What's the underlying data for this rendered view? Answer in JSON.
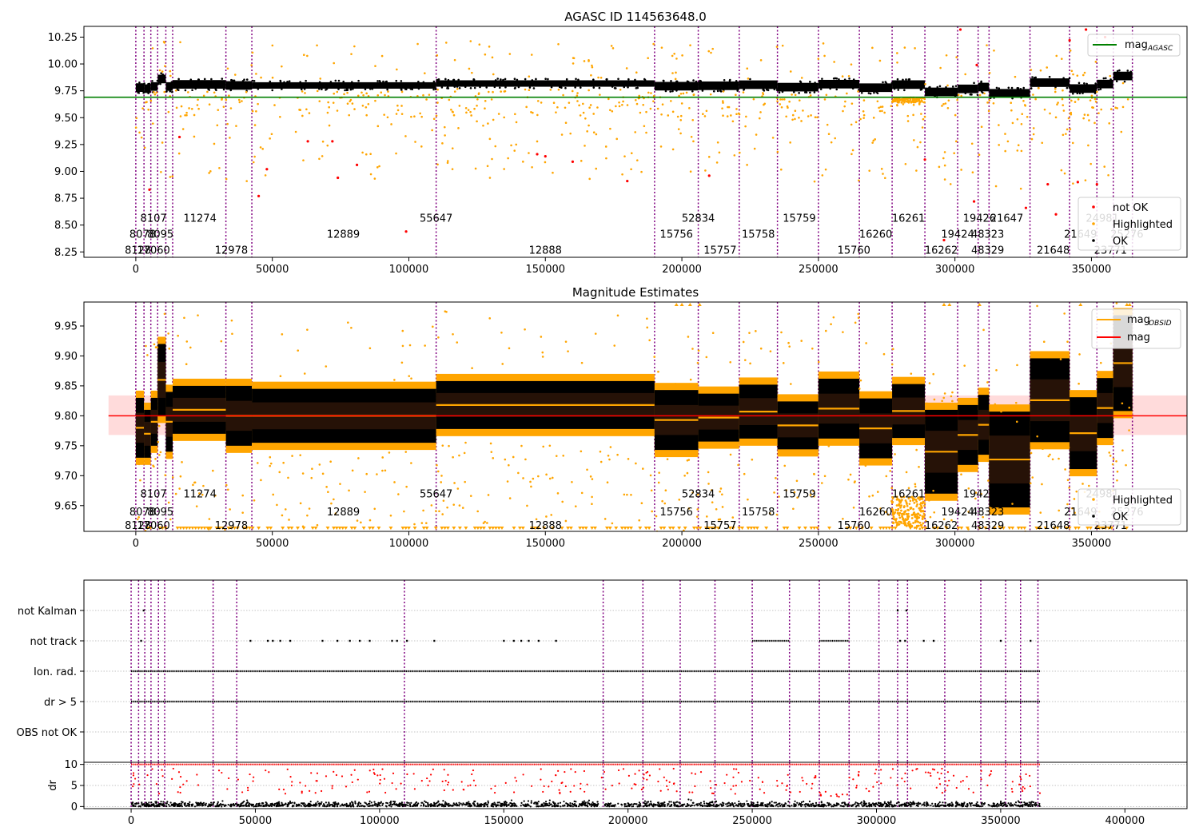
{
  "chart_data": [
    {
      "type": "scatter",
      "title": "AGASC ID 114563648.0",
      "xlim": [
        -19000,
        385000
      ],
      "ylim": [
        8.2,
        10.35
      ],
      "x_ticks": [
        0,
        50000,
        100000,
        150000,
        200000,
        250000,
        300000,
        350000,
        400000
      ],
      "x_tick_labels": [
        "0",
        "50000",
        "100000",
        "150000",
        "200000",
        "250000",
        "300000",
        "350000",
        "400000"
      ],
      "y_ticks": [
        8.25,
        8.5,
        8.75,
        9.0,
        9.25,
        9.5,
        9.75,
        10.0,
        10.25
      ],
      "y_tick_labels": [
        "8.25",
        "8.50",
        "8.75",
        "9.00",
        "9.25",
        "9.50",
        "9.75",
        "10.00",
        "10.25"
      ],
      "agasc_mag": 9.69,
      "agasc_line_range": [
        -19000,
        385000
      ],
      "legend_top": {
        "position": "top-right",
        "label": "mag",
        "subscript": "AGASC",
        "color": "#008000"
      },
      "legend_bottom": {
        "position": "lower-right",
        "entries": [
          {
            "label": "not OK",
            "color": "#ff0000"
          },
          {
            "label": "Highlighted",
            "color": "#ffa500"
          },
          {
            "label": "OK",
            "color": "#000000"
          }
        ]
      },
      "obsid_labels": [
        {
          "x": 800,
          "row": 0,
          "text": "8128"
        },
        {
          "x": 6500,
          "row": 0,
          "text": "17060"
        },
        {
          "x": 35000,
          "row": 0,
          "text": "12978"
        },
        {
          "x": 150000,
          "row": 0,
          "text": "12888"
        },
        {
          "x": 214000,
          "row": 0,
          "text": "15757"
        },
        {
          "x": 263000,
          "row": 0,
          "text": "15760"
        },
        {
          "x": 295000,
          "row": 0,
          "text": "16262"
        },
        {
          "x": 312000,
          "row": 0,
          "text": "48329"
        },
        {
          "x": 336000,
          "row": 0,
          "text": "21648"
        },
        {
          "x": 357000,
          "row": 0,
          "text": "23771"
        },
        {
          "x": 2500,
          "row": 1,
          "text": "8078"
        },
        {
          "x": 9000,
          "row": 1,
          "text": "8095"
        },
        {
          "x": 76000,
          "row": 1,
          "text": "12889"
        },
        {
          "x": 198000,
          "row": 1,
          "text": "15756"
        },
        {
          "x": 228000,
          "row": 1,
          "text": "15758"
        },
        {
          "x": 271000,
          "row": 1,
          "text": "16260"
        },
        {
          "x": 301000,
          "row": 1,
          "text": "19424"
        },
        {
          "x": 312000,
          "row": 1,
          "text": "48323"
        },
        {
          "x": 346000,
          "row": 1,
          "text": "21649"
        },
        {
          "x": 363000,
          "row": 1,
          "text": "25276"
        },
        {
          "x": 6500,
          "row": 2,
          "text": "8107"
        },
        {
          "x": 23500,
          "row": 2,
          "text": "11274"
        },
        {
          "x": 110000,
          "row": 2,
          "text": "55647"
        },
        {
          "x": 206000,
          "row": 2,
          "text": "52834"
        },
        {
          "x": 243000,
          "row": 2,
          "text": "15759"
        },
        {
          "x": 283000,
          "row": 2,
          "text": "16261"
        },
        {
          "x": 309000,
          "row": 2,
          "text": "19426"
        },
        {
          "x": 319000,
          "row": 2,
          "text": "21647"
        },
        {
          "x": 354000,
          "row": 2,
          "text": "24981"
        }
      ],
      "segments": [
        {
          "start": 0,
          "end": 3000,
          "mag": 9.78
        },
        {
          "start": 3000,
          "end": 5500,
          "mag": 9.77
        },
        {
          "start": 5500,
          "end": 8000,
          "mag": 9.79
        },
        {
          "start": 8000,
          "end": 11000,
          "mag": 9.86
        },
        {
          "start": 11000,
          "end": 13500,
          "mag": 9.79
        },
        {
          "start": 13500,
          "end": 33000,
          "mag": 9.81
        },
        {
          "start": 33000,
          "end": 42500,
          "mag": 9.8
        },
        {
          "start": 42500,
          "end": 110000,
          "mag": 9.8
        },
        {
          "start": 110000,
          "end": 190000,
          "mag": 9.818
        },
        {
          "start": 190000,
          "end": 206000,
          "mag": 9.793
        },
        {
          "start": 206000,
          "end": 221000,
          "mag": 9.797
        },
        {
          "start": 221000,
          "end": 235000,
          "mag": 9.807
        },
        {
          "start": 235000,
          "end": 250000,
          "mag": 9.784
        },
        {
          "start": 250000,
          "end": 265000,
          "mag": 9.812
        },
        {
          "start": 265000,
          "end": 277000,
          "mag": 9.779
        },
        {
          "start": 277000,
          "end": 289000,
          "mag": 9.808
        },
        {
          "start": 289000,
          "end": 301000,
          "mag": 9.74
        },
        {
          "start": 301000,
          "end": 308500,
          "mag": 9.768
        },
        {
          "start": 308500,
          "end": 312500,
          "mag": 9.785
        },
        {
          "start": 312500,
          "end": 327500,
          "mag": 9.727
        },
        {
          "start": 327500,
          "end": 342000,
          "mag": 9.826
        },
        {
          "start": 342000,
          "end": 352000,
          "mag": 9.771
        },
        {
          "start": 352000,
          "end": 358000,
          "mag": 9.813
        },
        {
          "start": 358000,
          "end": 365000,
          "mag": 9.888
        }
      ],
      "obs_boundaries": [
        0,
        3000,
        5500,
        8000,
        11000,
        13500,
        33000,
        42500,
        110000,
        190000,
        206000,
        221000,
        235000,
        250000,
        265000,
        277000,
        289000,
        301000,
        308500,
        312500,
        327500,
        342000,
        352000,
        358000,
        365000
      ]
    },
    {
      "type": "scatter",
      "title": "Magnitude Estimates",
      "xlim": [
        -19000,
        385000
      ],
      "ylim": [
        9.607,
        9.99
      ],
      "y_ticks": [
        9.65,
        9.7,
        9.75,
        9.8,
        9.85,
        9.9,
        9.95
      ],
      "y_tick_labels": [
        "9.65",
        "9.70",
        "9.75",
        "9.80",
        "9.85",
        "9.90",
        "9.95"
      ],
      "mean_mag": 9.8,
      "mag_band": [
        9.768,
        9.834
      ],
      "legend_top": {
        "position": "top-right",
        "entries": [
          {
            "label": "mag",
            "subscript": "OBSID",
            "color": "#ffa500"
          },
          {
            "label": "mag",
            "subscript": "",
            "color": "#ff0000"
          }
        ]
      },
      "legend_bottom": {
        "position": "lower-right",
        "entries": [
          {
            "label": "Highlighted",
            "color": "#ffa500"
          },
          {
            "label": "OK",
            "color": "#000000"
          }
        ]
      }
    },
    {
      "type": "scatter",
      "title": "",
      "xlim": [
        -19000,
        425000
      ],
      "flags": [
        "OBS not OK",
        "dr > 5",
        "Ion. rad.",
        "not track",
        "not Kalman"
      ],
      "flag_tracks": [
        {
          "flag": "not Kalman",
          "ranges": [],
          "points": [
            5000,
            308500,
            312000
          ]
        },
        {
          "flag": "not track",
          "ranges": [
            [
              250000,
              265000
            ],
            [
              277000,
              289000
            ]
          ],
          "points": [
            4000,
            48000,
            55000,
            57000,
            60000,
            64000,
            77000,
            83000,
            88000,
            92000,
            96000,
            105000,
            107000,
            111000,
            122000,
            150000,
            154000,
            157000,
            160000,
            164000,
            171000,
            309500,
            311500,
            319000,
            323000,
            350000,
            362000
          ]
        },
        {
          "flag": "Ion. rad.",
          "ranges": [
            [
              0,
              366000
            ]
          ],
          "points": []
        },
        {
          "flag": "dr > 5",
          "ranges": [
            [
              0,
              366000
            ]
          ],
          "points": []
        }
      ]
    },
    {
      "type": "scatter",
      "title": "",
      "xlim": [
        -19000,
        425000
      ],
      "ylim": [
        -0.5,
        10.5
      ],
      "ylabel": "dr",
      "y_ticks": [
        0,
        5,
        10
      ],
      "y_tick_labels": [
        "0",
        "5",
        "10"
      ],
      "dr_cap": 10,
      "points_ok_color": "#000000",
      "points_not_ok_color": "#ff0000"
    }
  ]
}
